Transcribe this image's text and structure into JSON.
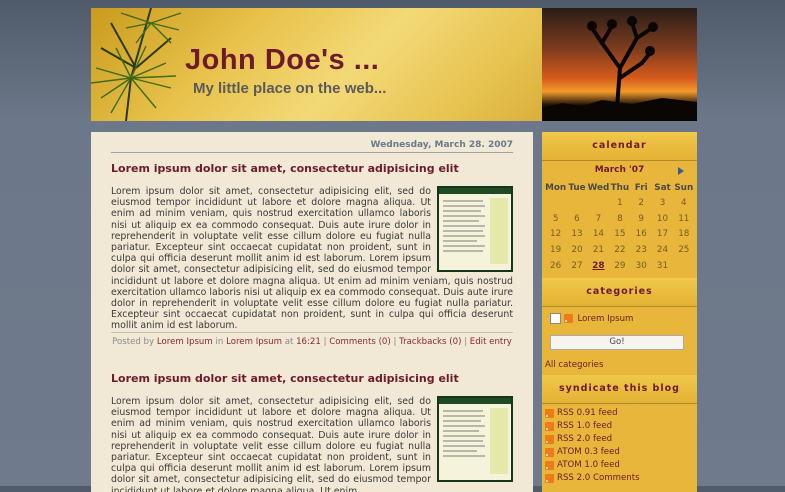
{
  "header": {
    "title": "John Doe's ...",
    "tagline": "My little place on the web..."
  },
  "date": "Wednesday, March 28. 2007",
  "posts": [
    {
      "title": "Lorem ipsum dolor sit amet, consectetur adipisicing elit",
      "body": "Lorem ipsum dolor sit amet, consectetur adipisicing elit, sed do eiusmod tempor incididunt ut labore et dolore magna aliqua. Ut enim ad minim veniam, quis nostrud exercitation ullamco laboris nisi ut aliquip ex ea commodo consequat. Duis aute irure dolor in reprehenderit in voluptate velit esse cillum dolore eu fugiat nulla pariatur. Excepteur sint occaecat cupidatat non proident, sunt in culpa qui officia deserunt mollit anim id est laborum. Lorem ipsum dolor sit amet, consectetur adipisicing elit, sed do eiusmod tempor incididunt ut labore et dolore magna aliqua. Ut enim ad minim veniam, quis nostrud exercitation ullamco laboris nisi ut aliquip ex ea commodo consequat. Duis aute irure dolor in reprehenderit in voluptate velit esse cillum dolore eu fugiat nulla pariatur. Excepteur sint occaecat cupidatat non proident, sunt in culpa qui officia deserunt mollit anim id est laborum.",
      "footer": {
        "posted_by": "Posted by",
        "author": "Lorem Ipsum",
        "in_word": "in",
        "category": "Lorem Ipsum",
        "at_word": "at",
        "time": "16:21",
        "sep": "|",
        "comments": "Comments (0)",
        "trackbacks": "Trackbacks (0)",
        "edit": "Edit entry"
      }
    },
    {
      "title": "Lorem ipsum dolor sit amet, consectetur adipisicing elit",
      "body": "Lorem ipsum dolor sit amet, consectetur adipisicing elit, sed do eiusmod tempor incididunt ut labore et dolore magna aliqua. Ut enim ad minim veniam, quis nostrud exercitation ullamco laboris nisi ut aliquip ex ea commodo consequat. Duis aute irure dolor in reprehenderit in voluptate velit esse cillum dolore eu fugiat nulla pariatur. Excepteur sint occaecat cupidatat non proident, sunt in culpa qui officia deserunt mollit anim id est laborum. Lorem ipsum dolor sit amet, consectetur adipisicing elit, sed do eiusmod tempor incididunt ut labore et dolore magna aliqua. Ut enim"
    }
  ],
  "sidebar": {
    "calendar": {
      "title": "calendar",
      "month": "March '07",
      "days": [
        "Mon",
        "Tue",
        "Wed",
        "Thu",
        "Fri",
        "Sat",
        "Sun"
      ],
      "weeks": [
        [
          "",
          "",
          "",
          "1",
          "2",
          "3",
          "4"
        ],
        [
          "5",
          "6",
          "7",
          "8",
          "9",
          "10",
          "11"
        ],
        [
          "12",
          "13",
          "14",
          "15",
          "16",
          "17",
          "18"
        ],
        [
          "19",
          "20",
          "21",
          "22",
          "23",
          "24",
          "25"
        ],
        [
          "26",
          "27",
          "28",
          "29",
          "30",
          "31",
          ""
        ]
      ],
      "today": "28"
    },
    "categories": {
      "title": "categories",
      "item": "Lorem Ipsum",
      "go_button": "Go!",
      "all": "All categories"
    },
    "syndicate": {
      "title": "syndicate this blog",
      "feeds": [
        "RSS 0.91 feed",
        "RSS 1.0 feed",
        "RSS 2.0 feed",
        "ATOM 0.3 feed",
        "ATOM 1.0 feed",
        "RSS 2.0 Comments"
      ]
    }
  },
  "colors": {
    "accent": "#6e1a2a",
    "sidebar": "#e7b63a",
    "content_bg": "#f1e8d6"
  }
}
